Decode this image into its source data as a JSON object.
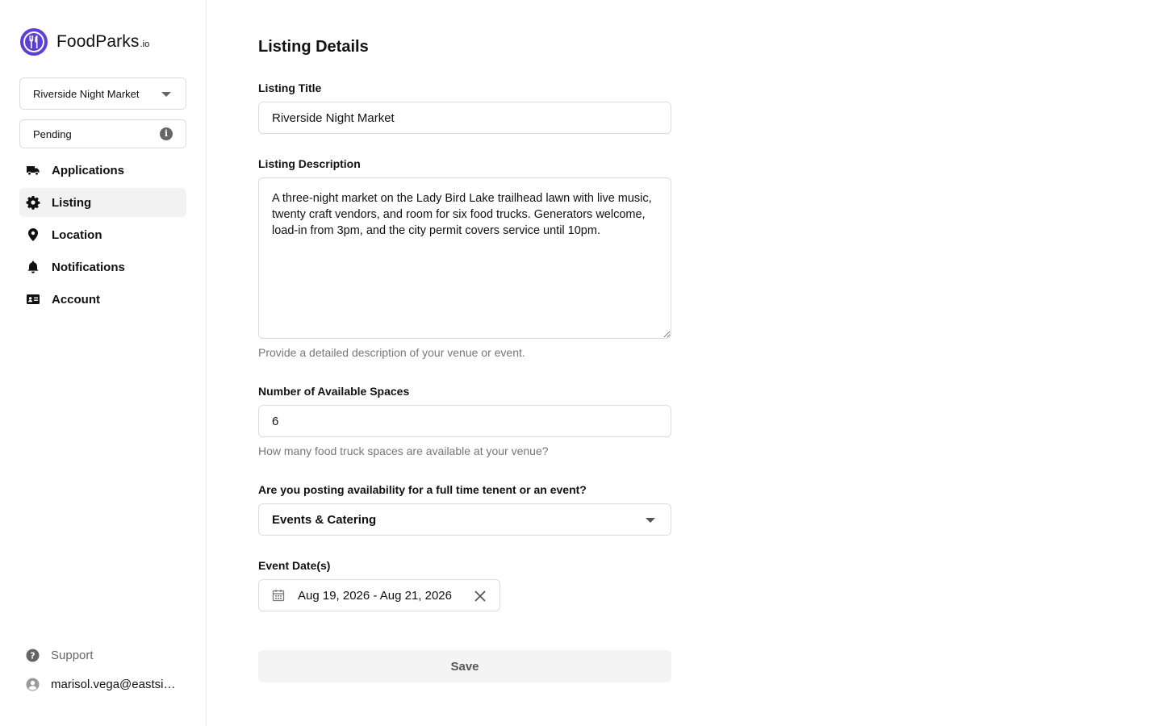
{
  "brand": {
    "name": "FoodParks",
    "tld": ".io",
    "accent": "#5b3fd6"
  },
  "sidebar": {
    "venue_select": "Riverside Night Market",
    "status": "Pending",
    "nav": [
      {
        "label": "Applications",
        "icon": "truck-icon"
      },
      {
        "label": "Listing",
        "icon": "gear-icon",
        "active": true
      },
      {
        "label": "Location",
        "icon": "map-pin-icon"
      },
      {
        "label": "Notifications",
        "icon": "bell-icon"
      },
      {
        "label": "Account",
        "icon": "id-card-icon"
      }
    ],
    "support": "Support",
    "user_email": "marisol.vega@eastside.com"
  },
  "main": {
    "title": "Listing Details",
    "listing_title": {
      "label": "Listing Title",
      "value": "Riverside Night Market"
    },
    "listing_description": {
      "label": "Listing Description",
      "value": "A three-night market on the Lady Bird Lake trailhead lawn with live music, twenty craft vendors, and room for six food trucks. Generators welcome, load-in from 3pm, and the city permit covers service until 10pm.",
      "hint": "Provide a detailed description of your venue or event."
    },
    "spaces": {
      "label": "Number of Available Spaces",
      "value": "6",
      "hint": "How many food truck spaces are available at your venue?"
    },
    "tenant_type": {
      "label": "Are you posting availability for a full time tenent or an event?",
      "value": "Events & Catering"
    },
    "event_dates": {
      "label": "Event Date(s)",
      "value": "Aug 19, 2026 - Aug 21, 2026"
    },
    "save_label": "Save"
  }
}
